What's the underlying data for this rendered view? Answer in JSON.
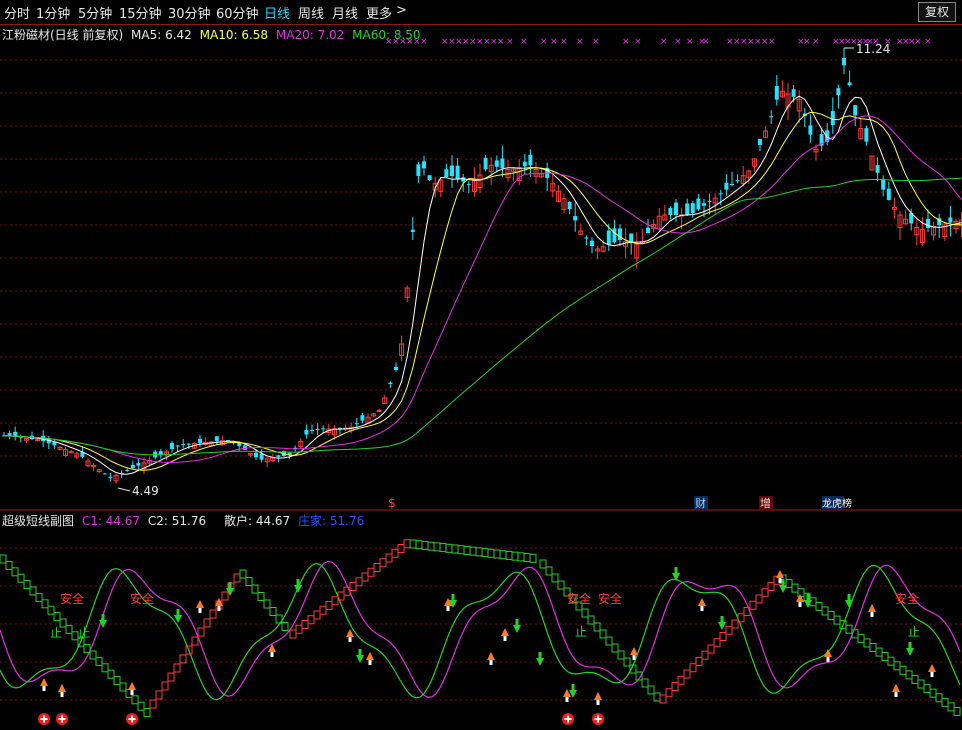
{
  "periods": [
    "分时",
    "1分钟",
    "5分钟",
    "15分钟",
    "30分钟",
    "60分钟",
    "日线",
    "周线",
    "月线",
    "更多"
  ],
  "active_period": "日线",
  "more_arrow": ">",
  "adjust_button": "复权",
  "main": {
    "stock_label": "江粉磁材(日线 前复权)",
    "ma5": "MA5: 6.42",
    "ma10": "MA10: 6.58",
    "ma20": "MA20: 7.02",
    "ma60": "MA60: 8.50",
    "high_label": "11.24",
    "low_label": "4.49",
    "markers": [
      "$",
      "财",
      "增",
      "龙虎榜"
    ]
  },
  "sub": {
    "title": "超级短线副图",
    "c1": "C1: 44.67",
    "c2": "C2: 51.76",
    "retail": "散户: 44.67",
    "banker": "庄家: 51.76",
    "safe_label": "安全",
    "stop_label": "止"
  },
  "colors": {
    "up": "#ff3b3b",
    "down": "#25e3ff",
    "ma5": "#ffffff",
    "ma10": "#ffff4c",
    "ma20": "#e030e0",
    "ma60": "#26d226",
    "grid": "#7a1010"
  }
}
